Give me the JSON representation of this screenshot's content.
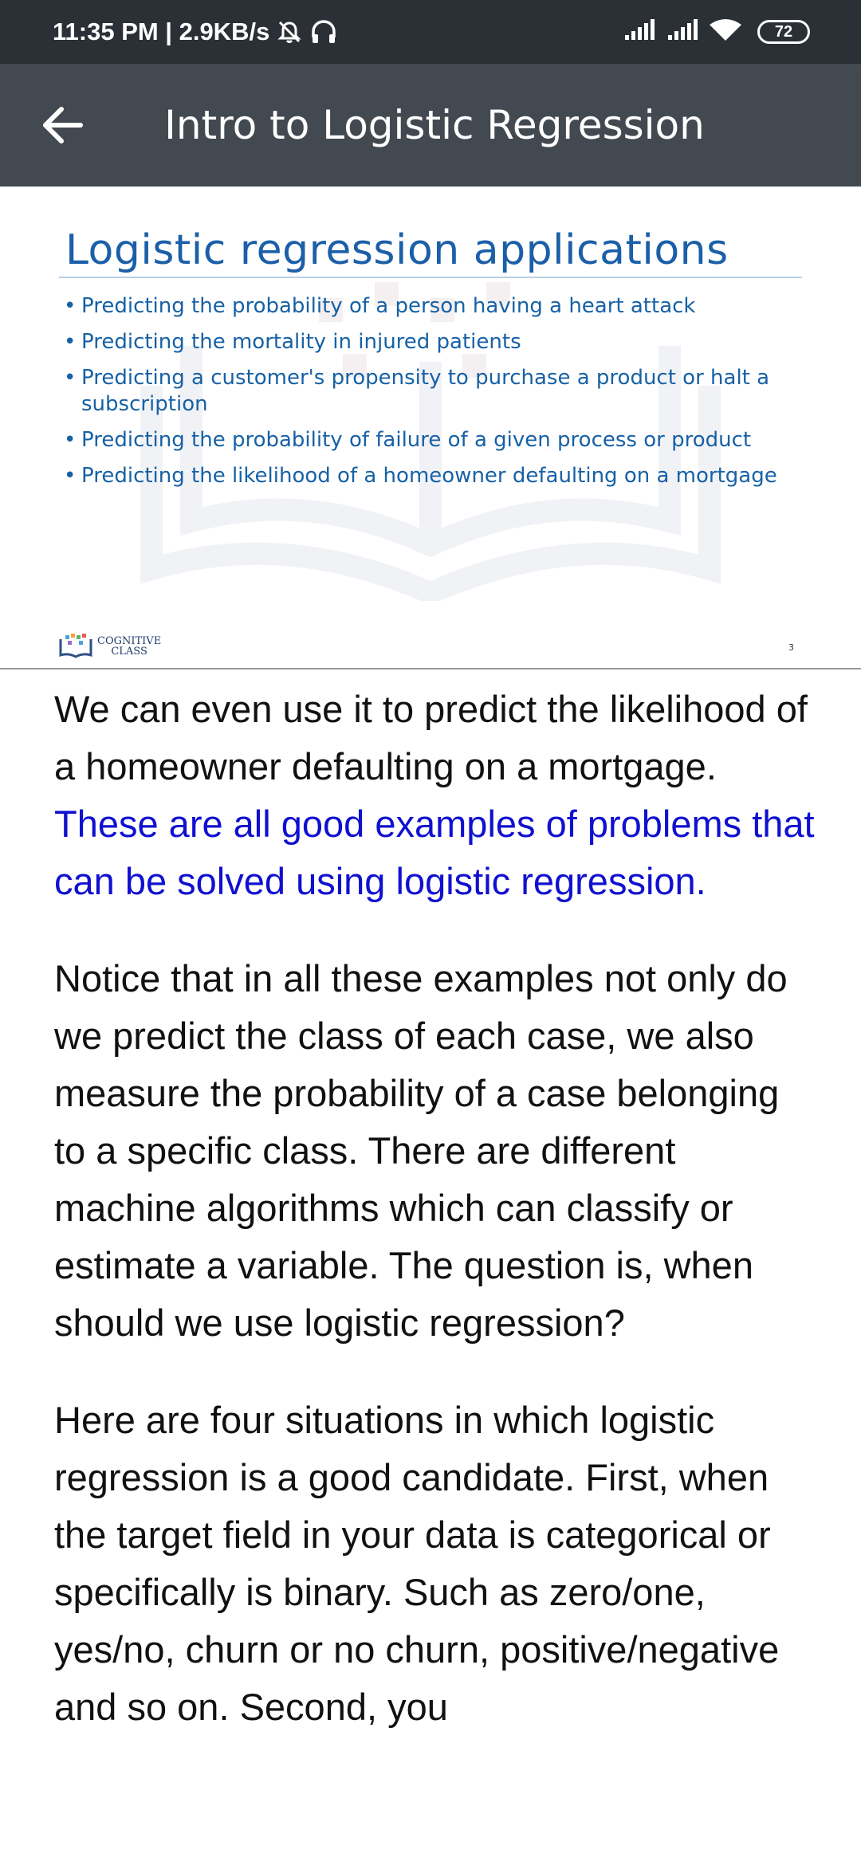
{
  "status_bar": {
    "time_speed": "11:35 PM | 2.9KB/s",
    "battery": "72",
    "icons": [
      "alarm-off-icon",
      "headset-icon",
      "signal-icon",
      "signal-icon",
      "wifi-icon",
      "battery-icon"
    ]
  },
  "app_bar": {
    "title": "Intro to Logistic Regression",
    "back_icon": "arrow-left-icon"
  },
  "slide": {
    "title": "Logistic regression applications",
    "bullets": [
      "Predicting the probability of a person having a heart attack",
      "Predicting the mortality in injured patients",
      "Predicting a customer's propensity to purchase a product or halt a subscription",
      "Predicting the probability of failure of a given process or product",
      "Predicting the likelihood of a homeowner defaulting on a mortgage"
    ],
    "logo_line1": "COGNITIVE",
    "logo_line2": "CLASS",
    "page_number": "3",
    "colors": {
      "title": "#1b5fa8",
      "bullets": "#1761a5"
    }
  },
  "transcript": {
    "p1_plain": "We can even use it to predict the likelihood of a homeowner defaulting on a mortgage. ",
    "p1_highlight": "These are all good examples of problems that can be solved using logistic regression.",
    "p2": "Notice that in all these examples not only do we predict the class of each case, we also measure the probability of a case belonging to a specific class. There are different machine algorithms which can classify or estimate a variable. The question is, when should we use logistic regression?",
    "p3": "Here are four situations in which logistic regression is a good candidate. First, when the target field in your data is categorical or specifically is binary. Such as zero/one, yes/no, churn or no churn, positive/negative and so on. Second, you",
    "colors": {
      "text": "#111111",
      "highlight": "#1010d0"
    }
  }
}
